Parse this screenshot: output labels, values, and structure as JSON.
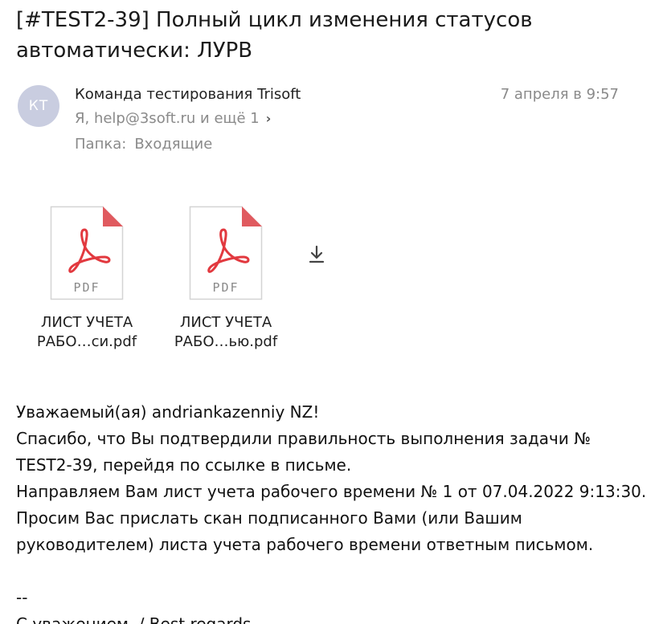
{
  "email": {
    "subject": "[#TEST2-39] Полный цикл изменения статусов автоматически: ЛУРВ",
    "sender": {
      "initials": "КТ",
      "name": "Команда тестирования Trisoft",
      "avatar_color": "#c9cde0"
    },
    "recipients": "Я, help@3soft.ru и ещё 1",
    "folder_label": "Папка:",
    "folder_value": "Входящие",
    "date": "7 апреля в 9:57"
  },
  "attachments": [
    {
      "name_line1": "ЛИСТ УЧЕТА",
      "name_line2": "РАБО…си.pdf",
      "type_label": "PDF",
      "icon": "pdf-icon"
    },
    {
      "name_line1": "ЛИСТ УЧЕТА",
      "name_line2": "РАБО…ью.pdf",
      "type_label": "PDF",
      "icon": "pdf-icon"
    }
  ],
  "download_icon": "download-icon",
  "body": {
    "greeting": "Уважаемый(ая) andriankazenniy NZ!",
    "line1": "Спасибо, что Вы подтвердили правильность выполнения задачи № TEST2-39, перейдя по ссылке в письме.",
    "line2": "Направляем Вам лист учета рабочего времени № 1 от 07.04.2022 9:13:30. Просим Вас прислать скан подписанного Вами (или Вашим руководителем) листа учета рабочего времени ответным письмом.",
    "signature_separator": "--",
    "closing": "С уважением, / Best regards,"
  },
  "colors": {
    "pdf_red": "#e2393f",
    "fold_red": "#e05a5f",
    "muted_text": "#8a8a8a"
  }
}
